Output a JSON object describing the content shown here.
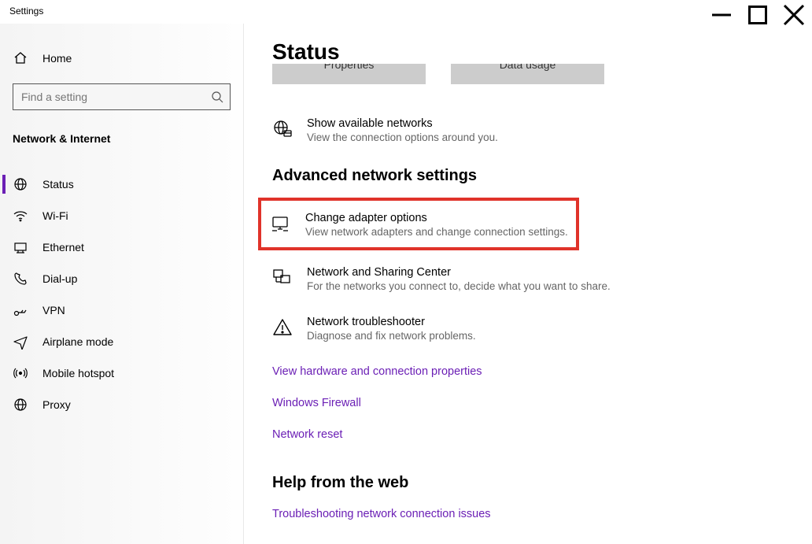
{
  "window": {
    "title": "Settings"
  },
  "sidebar": {
    "home": "Home",
    "search_placeholder": "Find a setting",
    "category": "Network & Internet",
    "items": [
      {
        "label": "Status"
      },
      {
        "label": "Wi-Fi"
      },
      {
        "label": "Ethernet"
      },
      {
        "label": "Dial-up"
      },
      {
        "label": "VPN"
      },
      {
        "label": "Airplane mode"
      },
      {
        "label": "Mobile hotspot"
      },
      {
        "label": "Proxy"
      }
    ]
  },
  "main": {
    "heading": "Status",
    "top_buttons": {
      "properties": "Properties",
      "data_usage": "Data usage"
    },
    "available": {
      "title": "Show available networks",
      "sub": "View the connection options around you."
    },
    "adv_heading": "Advanced network settings",
    "adapter": {
      "title": "Change adapter options",
      "sub": "View network adapters and change connection settings."
    },
    "sharing": {
      "title": "Network and Sharing Center",
      "sub": "For the networks you connect to, decide what you want to share."
    },
    "troubleshoot": {
      "title": "Network troubleshooter",
      "sub": "Diagnose and fix network problems."
    },
    "links": {
      "hw": "View hardware and connection properties",
      "fw": "Windows Firewall",
      "reset": "Network reset"
    },
    "help_heading": "Help from the web",
    "help_link": "Troubleshooting network connection issues"
  }
}
